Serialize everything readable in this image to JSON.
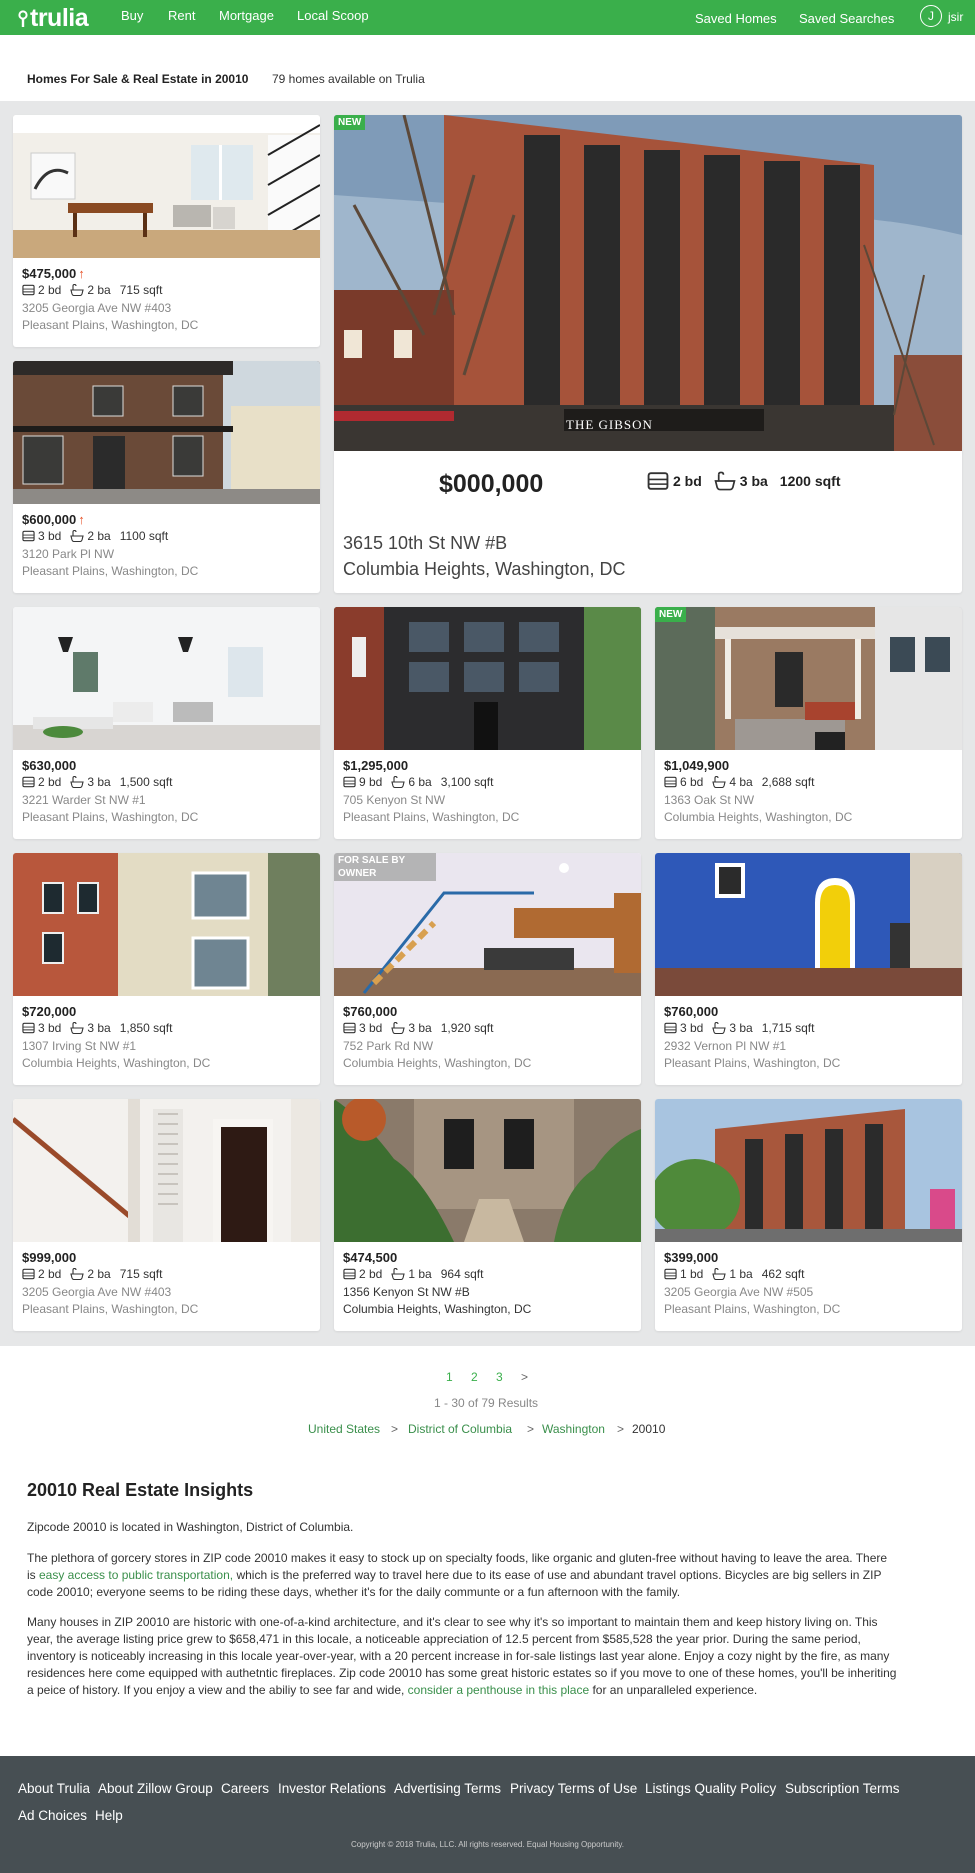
{
  "header": {
    "logo": "trulia",
    "nav": [
      "Buy",
      "Rent",
      "Mortgage",
      "Local Scoop"
    ],
    "saved_homes": "Saved Homes",
    "saved_searches": "Saved Searches",
    "avatar_initial": "J",
    "user_name": "jsir",
    "brand_color": "#3aaf4b"
  },
  "title": {
    "heading": "Homes For Sale & Real Estate in 20010",
    "count": "79 homes available on Trulia"
  },
  "featured": {
    "badge": "NEW",
    "price": "$000,000",
    "beds": "2 bd",
    "baths": "3 ba",
    "sqft": "1200 sqft",
    "address": "3615 10th St NW #B",
    "city": "Columbia Heights, Washington, DC",
    "sign": "THE GIBSON"
  },
  "listings": [
    {
      "price": "$475,000",
      "arrow": "↑",
      "beds": "2 bd",
      "baths": "2 ba",
      "sqft": "715 sqft",
      "address": "3205 Georgia Ave NW #403",
      "city": "Pleasant Plains, Washington, DC",
      "badge": ""
    },
    {
      "price": "$600,000",
      "arrow": "↑",
      "beds": "3 bd",
      "baths": "2 ba",
      "sqft": "1100 sqft",
      "address": "3120 Park Pl NW",
      "city": "Pleasant Plains, Washington, DC",
      "badge": ""
    },
    {
      "price": "$630,000",
      "arrow": "",
      "beds": "2 bd",
      "baths": "3 ba",
      "sqft": "1,500 sqft",
      "address": "3221 Warder St NW #1",
      "city": "Pleasant Plains, Washington, DC",
      "badge": ""
    },
    {
      "price": "$1,295,000",
      "arrow": "",
      "beds": "9 bd",
      "baths": "6 ba",
      "sqft": "3,100 sqft",
      "address": "705 Kenyon St NW",
      "city": "Pleasant Plains, Washington, DC",
      "badge": ""
    },
    {
      "price": "$1,049,900",
      "arrow": "",
      "beds": "6 bd",
      "baths": "4 ba",
      "sqft": "2,688 sqft",
      "address": "1363 Oak St NW",
      "city": "Columbia Heights, Washington, DC",
      "badge": "NEW"
    },
    {
      "price": "$720,000",
      "arrow": "",
      "beds": "3 bd",
      "baths": "3 ba",
      "sqft": "1,850 sqft",
      "address": "1307 Irving St NW #1",
      "city": "Columbia Heights, Washington, DC",
      "badge": ""
    },
    {
      "price": "$760,000",
      "arrow": "",
      "beds": "3 bd",
      "baths": "3 ba",
      "sqft": "1,920 sqft",
      "address": "752 Park Rd NW",
      "city": "Columbia Heights, Washington, DC",
      "badge": "FOR SALE BY OWNER"
    },
    {
      "price": "$760,000",
      "arrow": "",
      "beds": "3 bd",
      "baths": "3 ba",
      "sqft": "1,715 sqft",
      "address": "2932 Vernon Pl NW #1",
      "city": "Pleasant Plains, Washington, DC",
      "badge": ""
    },
    {
      "price": "$999,000",
      "arrow": "",
      "beds": "2 bd",
      "baths": "2 ba",
      "sqft": "715 sqft",
      "address": "3205 Georgia Ave NW #403",
      "city": "Pleasant Plains, Washington, DC",
      "badge": ""
    },
    {
      "price": "$474,500",
      "arrow": "",
      "beds": "2 bd",
      "baths": "1 ba",
      "sqft": "964 sqft",
      "address": "1356 Kenyon St NW #B",
      "city": "Columbia Heights, Washington, DC",
      "badge": ""
    },
    {
      "price": "$399,000",
      "arrow": "",
      "beds": "1 bd",
      "baths": "1 ba",
      "sqft": "462 sqft",
      "address": "3205 Georgia Ave NW #505",
      "city": "Pleasant Plains, Washington, DC",
      "badge": ""
    }
  ],
  "pagination": {
    "pages": [
      "1",
      "2",
      "3"
    ],
    "next": ">",
    "results": "1 - 30 of 79 Results"
  },
  "breadcrumb": {
    "items": [
      "United States",
      "District of Columbia",
      "Washington"
    ],
    "current": "20010",
    "separator": ">"
  },
  "insights": {
    "title": "20010 Real Estate Insights",
    "p1": "Zipcode 20010 is located in Washington, District of Columbia.",
    "p2_a": "The plethora of gorcery stores in ZIP code 20010 makes it easy to stock up on specialty foods, like organic and gluten-free without having to leave the area. There is ",
    "p2_link": "easy access to public transportation,",
    "p2_b": " which is the preferred way to travel here due to its ease of use and abundant travel options. Bicycles are big sellers in ZIP code 20010; everyone seems to be riding these days, whether it's for the daily communte or a fun afternoon with the family.",
    "p3_a": "Many houses in ZIP 20010 are historic with one-of-a-kind architecture, and it's clear to see why it's so important to maintain them and keep history living on. This year, the average listing price grew to $658,471 in this locale, a noticeable appreciation of 12.5 percent from $585,528 the year prior. During the same period, inventory is noticeably increasing in this locale year-over-year, with a 20 percent increase in for-sale listings last year alone. Enjoy a cozy night by the fire, as many residences here come equipped with authetntic fireplaces. Zip code 20010 has some great historic estates so if you move to one of these homes, you'll be inheriting a peice of history. If you enjoy a view and the abiliy to see far and wide, ",
    "p3_link": "consider a penthouse in this place",
    "p3_b": " for an unparalleled experience."
  },
  "footer": {
    "links": [
      "About Trulia",
      "About Zillow Group",
      "Careers",
      "Investor Relations",
      "Advertising Terms",
      "Privacy Terms of Use",
      "Listings Quality Policy",
      "Subscription Terms",
      "Ad Choices",
      "Help"
    ],
    "copyright": "Copyright © 2018 Trulia, LLC. All rights reserved. Equal Housing Opportunity."
  }
}
